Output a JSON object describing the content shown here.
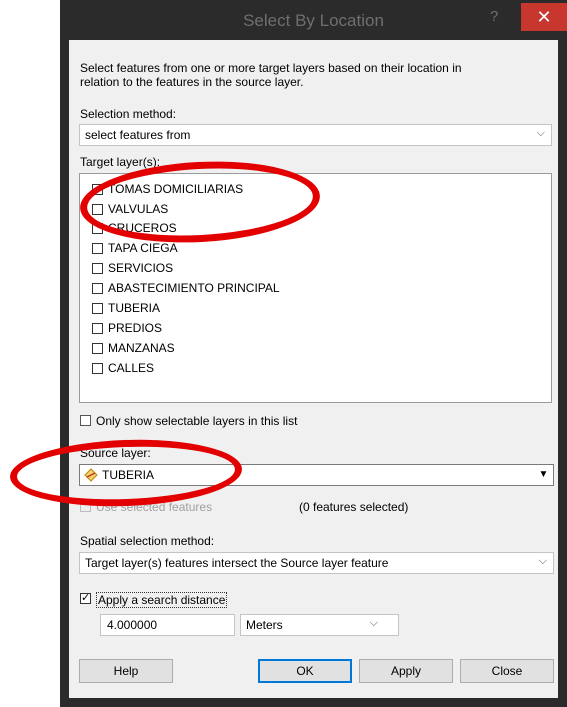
{
  "window": {
    "title": "Select By Location",
    "help_glyph": "?",
    "close_glyph": "✕"
  },
  "intro_text": [
    "Select features from one or more target layers based on their location in",
    "relation to the features in the source layer."
  ],
  "selection_method": {
    "label": "Selection method:",
    "value": "select features from"
  },
  "target_layers": {
    "label": "Target layer(s):",
    "items": [
      {
        "label": "TOMAS DOMICILIARIAS",
        "checked": true
      },
      {
        "label": "VALVULAS",
        "checked": false
      },
      {
        "label": "CRUCEROS",
        "checked": false
      },
      {
        "label": "TAPA CIEGA",
        "checked": false
      },
      {
        "label": "SERVICIOS",
        "checked": false
      },
      {
        "label": "ABASTECIMIENTO PRINCIPAL",
        "checked": false
      },
      {
        "label": "TUBERIA",
        "checked": false
      },
      {
        "label": "PREDIOS",
        "checked": false
      },
      {
        "label": "MANZANAS",
        "checked": false
      },
      {
        "label": "CALLES",
        "checked": false
      }
    ]
  },
  "only_selectable": {
    "label": "Only show selectable layers in this list",
    "checked": false
  },
  "source_layer": {
    "label": "Source layer:",
    "value": "TUBERIA",
    "use_selected_label": "Use selected features",
    "features_selected": "(0 features selected)"
  },
  "spatial_method": {
    "label": "Spatial selection method:",
    "value": "Target layer(s) features intersect the Source layer feature"
  },
  "search_distance": {
    "label": "Apply a search distance",
    "checked": true,
    "value": "4.000000",
    "unit": "Meters"
  },
  "buttons": {
    "help": "Help",
    "ok": "OK",
    "apply": "Apply",
    "close": "Close"
  },
  "colors": {
    "annotation_red": "#e30000",
    "title_bar": "#2b2b2b",
    "close_button": "#c7372e"
  }
}
